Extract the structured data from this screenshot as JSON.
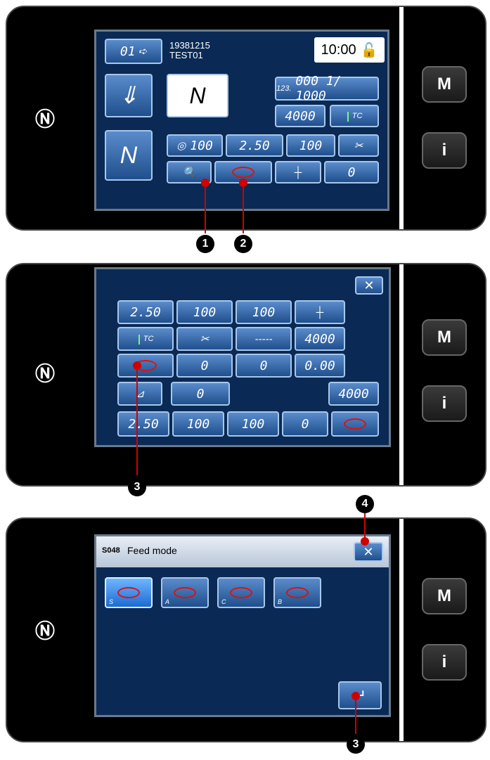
{
  "panel1": {
    "pattern_no": "01",
    "code": "19381215",
    "name": "TEST01",
    "time": "10:00",
    "counter": "000 1/ 1000",
    "counter_prefix": "123.",
    "bobbin": "4000",
    "tension": "100",
    "pitch": "2.50",
    "presser": "100",
    "offset": "0",
    "tc": "TC"
  },
  "panel2": {
    "pitch": "2.50",
    "tension": "100",
    "presser": "100",
    "bobbin": "4000",
    "tc": "TC",
    "offset1": "0",
    "offset2": "0",
    "pitch2": "0.00",
    "value0": "0",
    "bobbin2": "4000",
    "r5_pitch": "2.50",
    "r5_tension": "100",
    "r5_presser": "100",
    "r5_offset": "0"
  },
  "panel3": {
    "title_code": "S048",
    "title": "Feed mode",
    "modes": [
      "S",
      "A",
      "C",
      "B"
    ]
  },
  "side": {
    "m_label": "M",
    "i_label": "i"
  },
  "callouts": {
    "c1": "1",
    "c2": "2",
    "c3": "3",
    "c4": "4",
    "c3b": "3"
  },
  "colors": {
    "accent": "#1f4f8c",
    "highlight": "#d00000"
  }
}
